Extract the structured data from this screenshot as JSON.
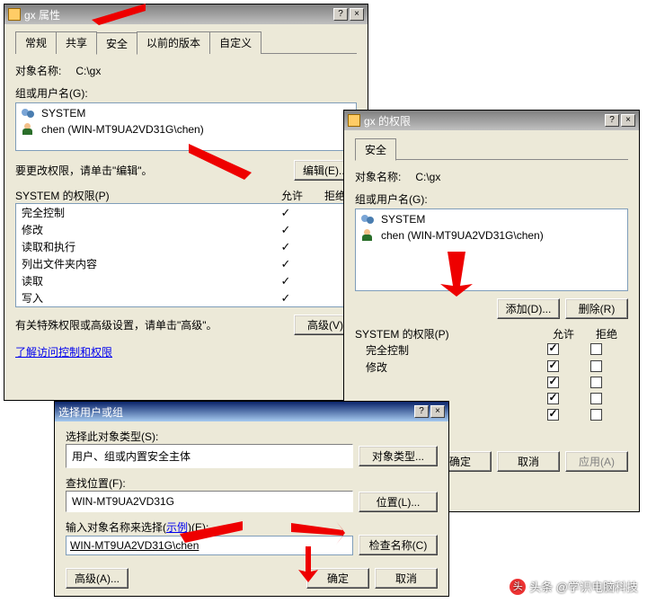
{
  "props": {
    "title": "gx 属性",
    "tabs": [
      "常规",
      "共享",
      "安全",
      "以前的版本",
      "自定义"
    ],
    "active_tab": "安全",
    "object_label": "对象名称:",
    "object_value": "C:\\gx",
    "group_label": "组或用户名(G):",
    "users": [
      {
        "type": "grp",
        "name": "SYSTEM"
      },
      {
        "type": "usr",
        "name": "chen (WIN-MT9UA2VD31G\\chen)"
      }
    ],
    "edit_hint": "要更改权限，请单击\"编辑\"。",
    "edit_btn": "编辑(E)...",
    "perm_label": "SYSTEM 的权限(P)",
    "allow": "允许",
    "deny": "拒绝",
    "perms": [
      "完全控制",
      "修改",
      "读取和执行",
      "列出文件夹内容",
      "读取",
      "写入"
    ],
    "adv_hint": "有关特殊权限或高级设置，请单击\"高级\"。",
    "adv_btn": "高级(V)",
    "acl_link": "了解访问控制和权限"
  },
  "perm": {
    "title": "gx 的权限",
    "tab": "安全",
    "object_label": "对象名称:",
    "object_value": "C:\\gx",
    "group_label": "组或用户名(G):",
    "users": [
      {
        "type": "grp",
        "name": "SYSTEM"
      },
      {
        "type": "usr",
        "name": "chen (WIN-MT9UA2VD31G\\chen)"
      }
    ],
    "add_btn": "添加(D)...",
    "remove_btn": "删除(R)",
    "perm_label": "SYSTEM 的权限(P)",
    "allow": "允许",
    "deny": "拒绝",
    "perms": [
      {
        "name": "完全控制",
        "allow": true,
        "deny": false
      },
      {
        "name": "修改",
        "allow": true,
        "deny": false
      },
      {
        "name": "",
        "allow": true,
        "deny": false
      },
      {
        "name": "",
        "allow": true,
        "deny": false
      },
      {
        "name": "",
        "allow": true,
        "deny": false
      }
    ],
    "ok": "确定",
    "cancel": "取消",
    "apply": "应用(A)"
  },
  "pick": {
    "title": "选择用户或组",
    "type_label": "选择此对象类型(S):",
    "type_value": "用户、组或内置安全主体",
    "type_btn": "对象类型...",
    "loc_label": "查找位置(F):",
    "loc_value": "WIN-MT9UA2VD31G",
    "loc_btn": "位置(L)...",
    "name_label_pre": "输入对象名称来选择(",
    "name_label_link": "示例",
    "name_label_post": ")(E):",
    "name_value": "WIN-MT9UA2VD31G\\chen",
    "check_btn": "检查名称(C)",
    "adv_btn": "高级(A)...",
    "ok": "确定",
    "cancel": "取消"
  },
  "watermark": "头条 @学识电脑科技"
}
